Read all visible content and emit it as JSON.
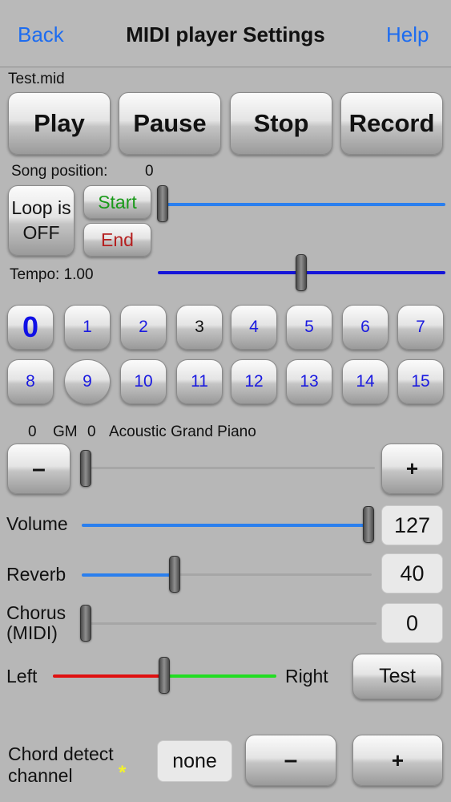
{
  "nav": {
    "back": "Back",
    "title": "MIDI player Settings",
    "help": "Help"
  },
  "file_name": "Test.mid",
  "transport": {
    "play": "Play",
    "pause": "Pause",
    "stop": "Stop",
    "record": "Record"
  },
  "song_position": {
    "label": "Song position:",
    "value": "0",
    "fraction": 0.0
  },
  "loop": {
    "label": "Loop is OFF",
    "start": "Start",
    "end": "End"
  },
  "tempo": {
    "label": "Tempo: 1.00",
    "fraction": 0.5
  },
  "channels": [
    "0",
    "1",
    "2",
    "3",
    "4",
    "5",
    "6",
    "7",
    "8",
    "9",
    "10",
    "11",
    "12",
    "13",
    "14",
    "15"
  ],
  "selected_channel": "0",
  "instrument": {
    "channel": "0",
    "gm_label": "GM",
    "program": "0",
    "name": "Acoustic Grand Piano",
    "minus": "–",
    "plus": "+",
    "fraction": 0.0
  },
  "volume": {
    "label": "Volume",
    "value": "127",
    "fraction": 1.0
  },
  "reverb": {
    "label": "Reverb",
    "value": "40",
    "fraction": 0.315
  },
  "chorus": {
    "label_line1": "Chorus",
    "label_line2": "(MIDI)",
    "value": "0",
    "fraction": 0.0
  },
  "pan": {
    "left": "Left",
    "right": "Right",
    "test": "Test",
    "fraction": 0.5
  },
  "chord_detect": {
    "line1": "Chord detect",
    "line2": "channel",
    "asterisk": "*",
    "value": "none",
    "minus": "–",
    "plus": "+"
  },
  "colors": {
    "accent": "#1d6cf0",
    "slider_blue": "#2a7fee",
    "tempo_blue": "#1515d8",
    "pan_left": "#e01010",
    "pan_right": "#22dd22",
    "start_green": "#1a9a1a",
    "end_red": "#b52020"
  }
}
